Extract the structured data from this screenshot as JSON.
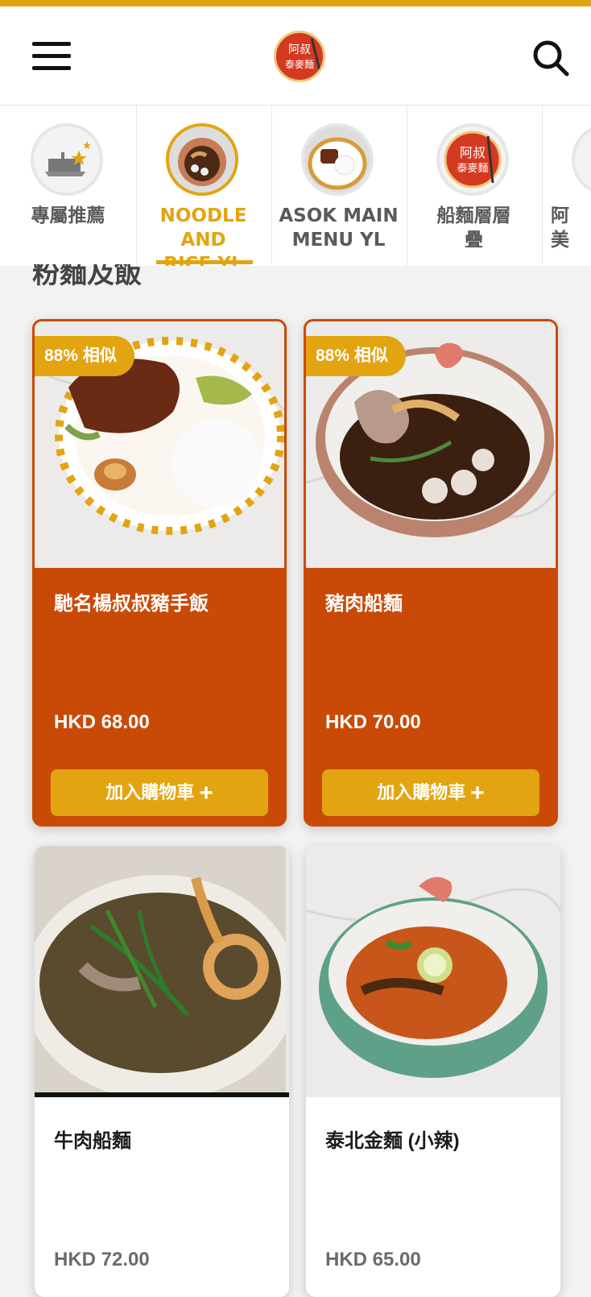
{
  "header": {
    "logo_text": "阿叔泰麥麵",
    "logo_line1": "阿叔",
    "logo_line2": "泰麥麵"
  },
  "tabs": [
    {
      "label_line1": "專屬推薦",
      "label_line2": "",
      "active": false
    },
    {
      "label_line1": "NOODLE AND",
      "label_line2": "RICE YL",
      "active": true
    },
    {
      "label_line1": "ASOK MAIN",
      "label_line2": "MENU YL",
      "active": false
    },
    {
      "label_line1": "船麵層層",
      "label_line2": "疊",
      "active": false
    },
    {
      "label_line1": "阿",
      "label_line2": "美",
      "active": false
    }
  ],
  "section_title": "粉麵及飯",
  "products": [
    {
      "name": "馳名楊叔叔豬手飯",
      "price": "HKD 68.00",
      "badge": "88% 相似",
      "button": "加入購物車"
    },
    {
      "name": "豬肉船麵",
      "price": "HKD 70.00",
      "badge": "88% 相似",
      "button": "加入購物車"
    },
    {
      "name": "牛肉船麵",
      "price": "HKD 72.00"
    },
    {
      "name": "泰北金麵 (小辣)",
      "price": "HKD 65.00"
    }
  ],
  "colors": {
    "accent": "#e3a411",
    "card_orange": "#c94a06"
  }
}
